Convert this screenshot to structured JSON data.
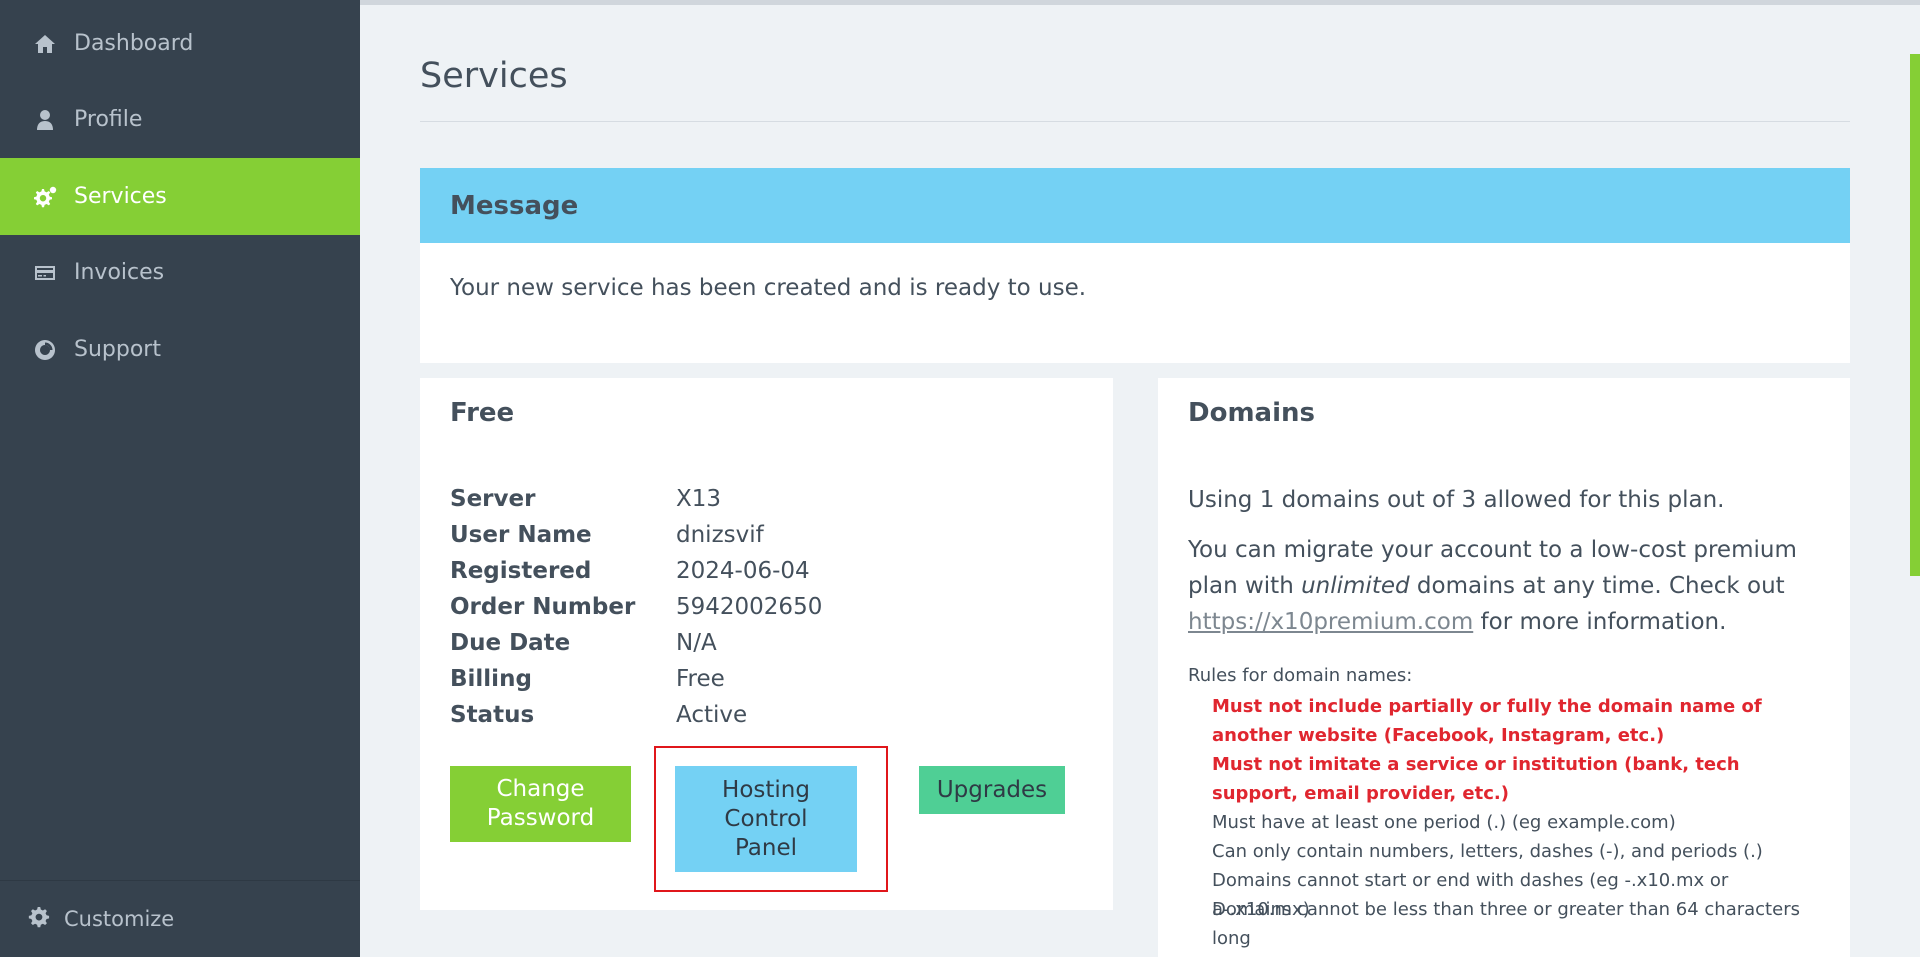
{
  "sidebar": {
    "items": [
      {
        "label": "Dashboard",
        "icon": "home-icon"
      },
      {
        "label": "Profile",
        "icon": "user-icon"
      },
      {
        "label": "Services",
        "icon": "gears-icon"
      },
      {
        "label": "Invoices",
        "icon": "credit-card-icon"
      },
      {
        "label": "Support",
        "icon": "life-ring-icon"
      }
    ],
    "active": "Services",
    "customize_label": "Customize"
  },
  "page": {
    "title": "Services"
  },
  "message": {
    "heading": "Message",
    "body": "Your new service has been created and is ready to use."
  },
  "service": {
    "heading": "Free",
    "rows": [
      {
        "label": "Server",
        "value": "X13"
      },
      {
        "label": "User Name",
        "value": "dnizsvif"
      },
      {
        "label": "Registered",
        "value": "2024-06-04"
      },
      {
        "label": "Order Number",
        "value": "5942002650"
      },
      {
        "label": "Due Date",
        "value": "N/A"
      },
      {
        "label": "Billing",
        "value": "Free"
      },
      {
        "label": "Status",
        "value": "Active"
      }
    ],
    "buttons": {
      "change_password_line1": "Change",
      "change_password_line2": "Password",
      "control_panel_line1": "Hosting",
      "control_panel_line2": "Control",
      "control_panel_line3": "Panel",
      "upgrades": "Upgrades"
    }
  },
  "domains": {
    "heading": "Domains",
    "usage": "Using 1 domains out of 3 allowed for this plan.",
    "migrate_before": "You can migrate your account to a low-cost premium plan with ",
    "migrate_emphasis": "unlimited",
    "migrate_middle": " domains at any time. Check out ",
    "migrate_link": "https://x10premium.com",
    "migrate_after": " for more information.",
    "rules_title": "Rules for domain names:",
    "rules": [
      {
        "text": "Must not include partially or fully the domain name of another website (Facebook, Instagram, etc.)",
        "important": true
      },
      {
        "text": "Must not imitate a service or institution (bank, tech support, email provider, etc.)",
        "important": true
      },
      {
        "text": "Must have at least one period (.) (eg example.com)",
        "important": false
      },
      {
        "text": "Can only contain numbers, letters, dashes (-), and periods (.)",
        "important": false
      },
      {
        "text": "Domains cannot start or end with dashes (eg -.x10.mx or a-.x10.mx)",
        "important": false
      },
      {
        "text": "Domains cannot be less than three or greater than 64 characters long",
        "important": false
      }
    ]
  },
  "colors": {
    "sidebar_bg": "#36424e",
    "accent_green": "#85cf35",
    "message_blue": "#74d1f4",
    "upgrade_teal": "#4fcf95",
    "warning_red": "#e0262f",
    "highlight_red": "#e0161b"
  }
}
